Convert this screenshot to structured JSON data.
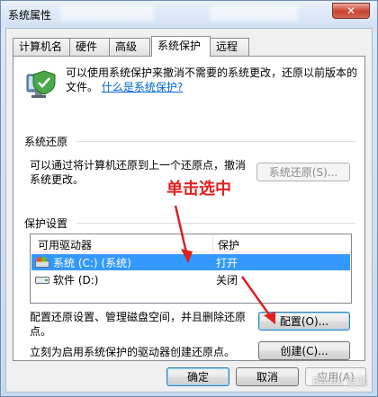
{
  "window": {
    "title": "系统属性",
    "close_label": "✕"
  },
  "tabs": [
    {
      "label": "计算机名"
    },
    {
      "label": "硬件"
    },
    {
      "label": "高级"
    },
    {
      "label": "系统保护"
    },
    {
      "label": "远程"
    }
  ],
  "intro": {
    "text": "可以使用系统保护来撤消不需要的系统更改，还原以前版本的文件。",
    "link": "什么是系统保护?",
    "icon": "system-protection-shield-icon"
  },
  "restore": {
    "heading": "系统还原",
    "description": "可以通过将计算机还原到上一个还原点，撤消系统更改。",
    "button": "系统还原(S)..."
  },
  "protection": {
    "heading": "保护设置",
    "columns": [
      "可用驱动器",
      "保护"
    ],
    "rows": [
      {
        "drive": "系统 (C:) (系统)",
        "state": "打开",
        "selected": true,
        "icon": "system-drive-icon"
      },
      {
        "drive": "软件 (D:)",
        "state": "关闭",
        "selected": false,
        "icon": "hard-drive-icon"
      }
    ],
    "configure_text": "配置还原设置、管理磁盘空间，并且删除还原点。",
    "configure_button": "配置(O)...",
    "create_text": "立刻为启用系统保护的驱动器创建还原点。",
    "create_button": "创建(C)..."
  },
  "annotation": {
    "text": "单击选中",
    "color": "#e02020"
  },
  "footer": {
    "ok": "确定",
    "cancel": "取消",
    "apply": "应用(A)",
    "watermark": "Baidu 经验"
  },
  "colors": {
    "selection": "#3399ff",
    "link": "#0066cc"
  }
}
